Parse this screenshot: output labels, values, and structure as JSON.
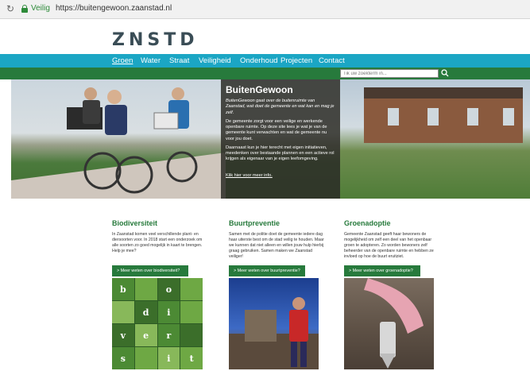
{
  "browser": {
    "reload_icon": "reload-icon",
    "secure_label": "Veilig",
    "url": "https://buitengewoon.zaanstad.nl"
  },
  "site": {
    "logo": "ZNSTD",
    "nav": [
      "Groen",
      "Water",
      "Straat",
      "Veiligheid",
      "Onderhoud",
      "Projecten",
      "Contact"
    ],
    "search_placeholder": "Tik uw zoekterm in...",
    "colors": {
      "primary": "#277a3c",
      "nav": "#1ba6c4",
      "overlay": "#2d2d28"
    }
  },
  "hero": {
    "title": "BuitenGewoon",
    "intro": "BuitenGewoon gaat over de buitenruimte van Zaanstad, wat doet de gemeente en wat kan en mag je zelf.",
    "p1": "De gemeente zorgt voor een veilige en werkende openbare ruimte. Op deze site lees je wat je van de gemeente kunt verwachten en wat de gemeente nu voor jou doet.",
    "p2": "Daarnaast kun je hier terecht met eigen initiatieven, meedenken over bestaande plannen en een actieve rol krijgen als eigenaar van je eigen leefomgeving.",
    "link": "Klik hier voor meer info."
  },
  "columns": [
    {
      "title": "Biodiversiteit",
      "text": "In Zaanstad komen veel verschillende plant- en diersoorten voor. In 2018 start een onderzoek om alle soorten zo goed mogelijk in kaart te brengen. Help je mee?",
      "button": "> Meer weten over biodiversiteit?",
      "image_letters": [
        "b",
        "",
        "o",
        "",
        "",
        "d",
        "i",
        "",
        "v",
        "e",
        "r",
        "",
        "s",
        "",
        "i",
        "t"
      ]
    },
    {
      "title": "Buurtpreventie",
      "text": "Samen met de politie doet de gemeente iedere dag haar uiterste best om de stad veilig te houden. Maar we kunnen dat niet alleen en willen jouw hulp hierbij graag gebruiken. Samen maken we Zaanstad veiliger!",
      "button": "> Meer weten over buurtpreventie?"
    },
    {
      "title": "Groenadoptie",
      "text": "Gemeente Zaanstad geeft haar bewoners de mogelijkheid om zelf een deel van het openbaar groen te adopteren. Zo worden bewoners zelf beheerder van de openbare ruimte en hebben ze invloed op hoe de buurt eruitziet.",
      "button": "> Meer weten over groenadoptie?"
    }
  ]
}
